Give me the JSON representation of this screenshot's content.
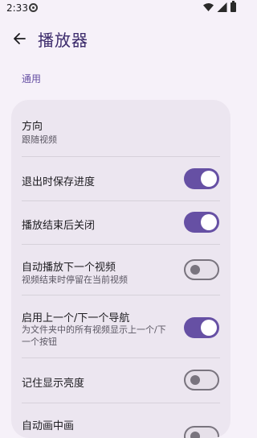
{
  "status_bar": {
    "time": "2:33"
  },
  "header": {
    "title": "播放器"
  },
  "section": {
    "label": "通用"
  },
  "settings": [
    {
      "title": "方向",
      "subtitle": "跟随视频"
    },
    {
      "title": "退出时保存进度",
      "enabled": true
    },
    {
      "title": "播放结束后关闭",
      "enabled": true
    },
    {
      "title": "自动播放下一个视频",
      "subtitle": "视频结束时停留在当前视频",
      "enabled": false
    },
    {
      "title": "启用上一个/下一个导航",
      "subtitle": "为文件夹中的所有视频显示上一个/下一个按钮",
      "enabled": true
    },
    {
      "title": "记住显示亮度",
      "enabled": false
    },
    {
      "title": "自动画中画",
      "enabled": false
    }
  ]
}
